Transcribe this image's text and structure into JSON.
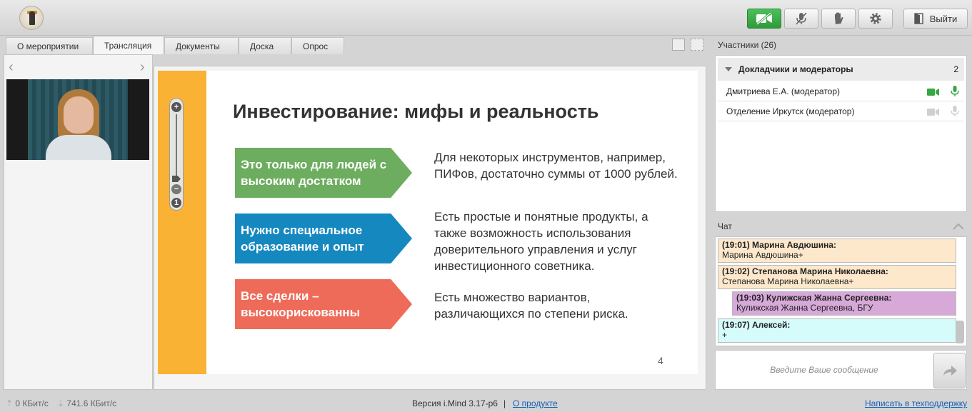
{
  "toolbar": {
    "exit_label": "Выйти",
    "icons": [
      "camera-off-icon",
      "mic-off-icon",
      "raise-hand-icon",
      "gear-icon",
      "exit-door-icon"
    ],
    "accent_color": "#34a843"
  },
  "tabs": [
    {
      "label": "О мероприятии",
      "active": false
    },
    {
      "label": "Трансляция",
      "active": true
    },
    {
      "label": "Документы",
      "active": false
    },
    {
      "label": "Доска",
      "active": false
    },
    {
      "label": "Опрос",
      "active": false
    }
  ],
  "slide": {
    "title": "Инвестирование: мифы и реальность",
    "items": [
      {
        "label": "Это только для людей с высоким достатком",
        "text": "Для некоторых инструментов, например, ПИФов, достаточно суммы от 1000 рублей.",
        "color": "#6dad5f"
      },
      {
        "label": "Нужно специальное образование и опыт",
        "text": "Есть простые и понятные продукты, а также возможность использования доверительного управления и услуг инвестиционного советника.",
        "color": "#1588c0"
      },
      {
        "label": "Все сделки – высокорискованны",
        "text": "Есть множество вариантов, различающихся по степени риска.",
        "color": "#ee6b5a"
      }
    ],
    "page_number": "4",
    "stripe_color": "#f9b233"
  },
  "participants": {
    "header": "Участники (26)",
    "group": {
      "name": "Докладчики и модераторы",
      "count": "2"
    },
    "list": [
      {
        "name": "Дмитриева Е.А. (модератор)",
        "camera_on": true,
        "mic_on": true
      },
      {
        "name": "Отделение Иркутск (модератор)",
        "camera_on": false,
        "mic_on": false
      }
    ]
  },
  "chat": {
    "header": "Чат",
    "messages": [
      {
        "head": "(19:01) Марина Авдюшина:",
        "body": "Марина Авдюшина+",
        "bg": "#fde8cc"
      },
      {
        "head": "(19:02) Степанова Марина Николаевна:",
        "body": "Степанова Марина Николаевна+",
        "bg": "#fde8cc"
      },
      {
        "head": "(19:03) Кулижская Жанна Сергеевна:",
        "body": "Кулижская Жанна Сергеевна, БГУ",
        "bg": "#d6a9d8"
      },
      {
        "head": "(19:07) Алексей:",
        "body": "+",
        "bg": "#d6fbfb"
      }
    ],
    "input_placeholder": "Введите Ваше сообщение"
  },
  "status": {
    "upload": "0 КБит/с",
    "download": "741.6 КБит/с",
    "version": "Версия i.Mind 3.17-p6",
    "separator": "|",
    "about_link": "О продукте",
    "support_link": "Написать в техподдержку"
  }
}
